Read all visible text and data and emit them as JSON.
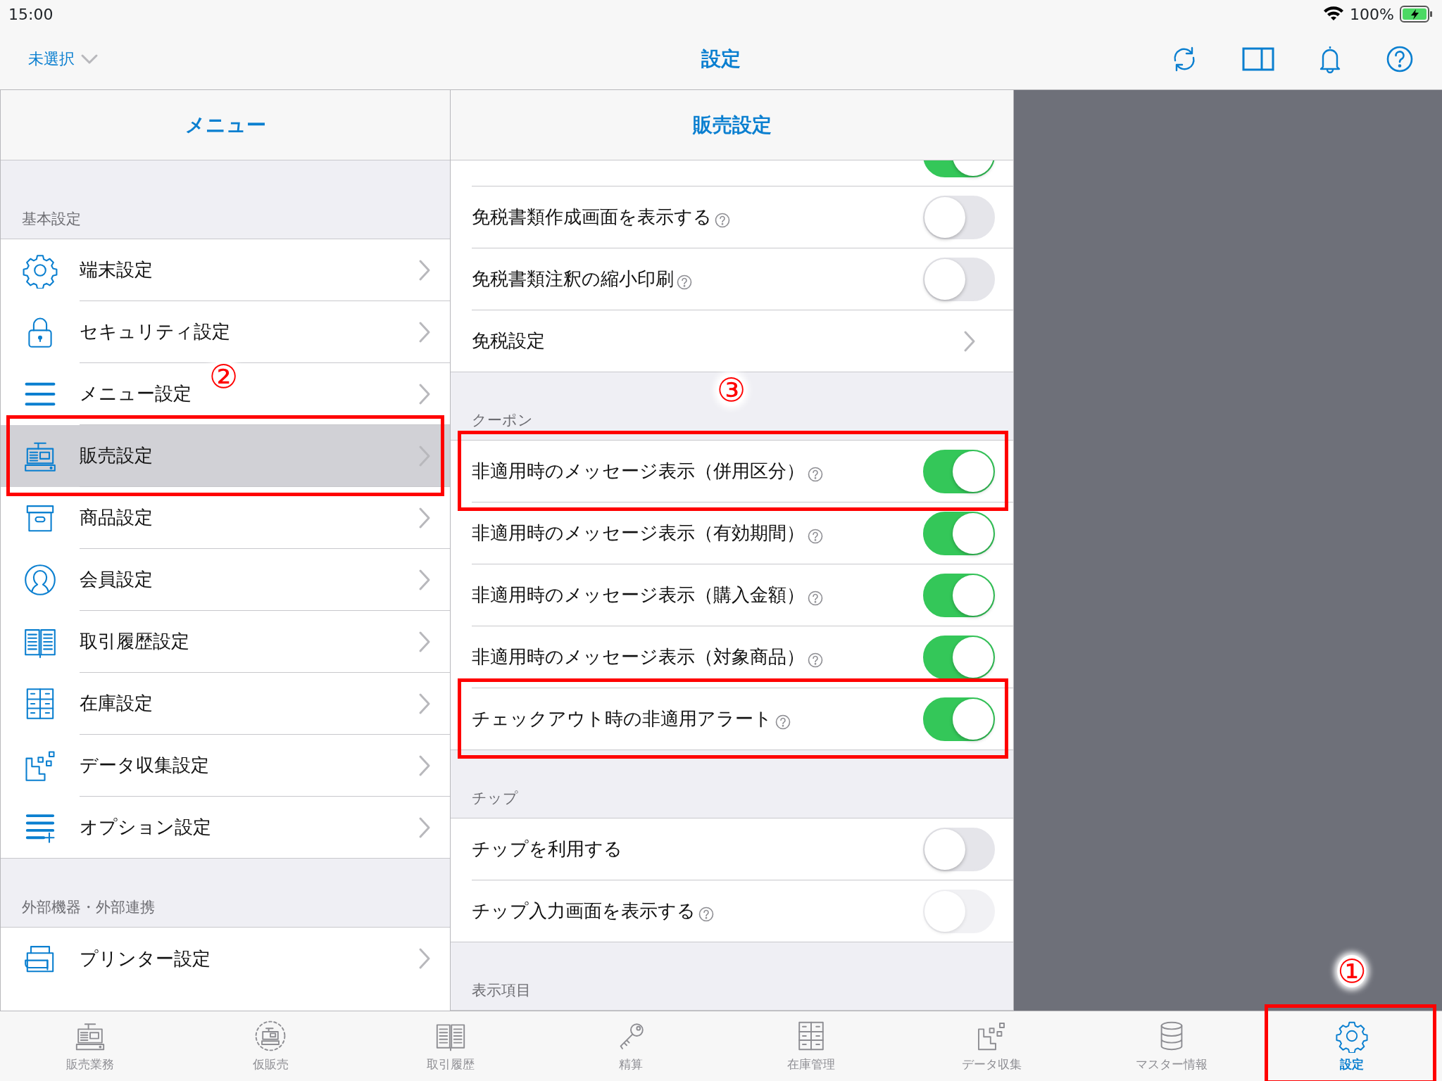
{
  "status_bar": {
    "time": "15:00",
    "battery": "100%"
  },
  "nav_bar": {
    "scope": "未選択",
    "title": "設定"
  },
  "menu": {
    "title": "メニュー",
    "sections": [
      {
        "header": "基本設定",
        "items": [
          {
            "label": "端末設定",
            "selected": false,
            "highlighted": false
          },
          {
            "label": "セキュリティ設定",
            "selected": false,
            "highlighted": false
          },
          {
            "label": "メニュー設定",
            "selected": false,
            "highlighted": false,
            "marker": "②"
          },
          {
            "label": "販売設定",
            "selected": true,
            "highlighted": true
          },
          {
            "label": "商品設定",
            "selected": false,
            "highlighted": false
          },
          {
            "label": "会員設定",
            "selected": false,
            "highlighted": false
          },
          {
            "label": "取引履歴設定",
            "selected": false,
            "highlighted": false
          },
          {
            "label": "在庫設定",
            "selected": false,
            "highlighted": false
          },
          {
            "label": "データ収集設定",
            "selected": false,
            "highlighted": false
          },
          {
            "label": "オプション設定",
            "selected": false,
            "highlighted": false
          }
        ]
      },
      {
        "header": "外部機器・外部連携",
        "items": [
          {
            "label": "プリンター設定",
            "selected": false,
            "highlighted": false
          }
        ]
      }
    ]
  },
  "detail": {
    "title": "販売設定",
    "sections": [
      {
        "rows": [
          {
            "kind": "toggle",
            "on": true,
            "disabled": false,
            "highlighted": false
          },
          {
            "kind": "toggle",
            "label": "免税書類作成画面を表示する",
            "help": true,
            "on": false,
            "disabled": false,
            "highlighted": false
          },
          {
            "kind": "toggle",
            "label": "免税書類注釈の縮小印刷",
            "help": true,
            "on": false,
            "disabled": false,
            "highlighted": false
          },
          {
            "kind": "link",
            "label": "免税設定",
            "highlighted": false
          }
        ]
      },
      {
        "header": "クーポン",
        "marker": "③",
        "rows": [
          {
            "kind": "toggle",
            "label": "非適用時のメッセージ表示（併用区分）",
            "help": true,
            "on": true,
            "disabled": false,
            "highlighted": true
          },
          {
            "kind": "toggle",
            "label": "非適用時のメッセージ表示（有効期間）",
            "help": true,
            "on": true,
            "disabled": false,
            "highlighted": false
          },
          {
            "kind": "toggle",
            "label": "非適用時のメッセージ表示（購入金額）",
            "help": true,
            "on": true,
            "disabled": false,
            "highlighted": false
          },
          {
            "kind": "toggle",
            "label": "非適用時のメッセージ表示（対象商品）",
            "help": true,
            "on": true,
            "disabled": false,
            "highlighted": false
          },
          {
            "kind": "toggle",
            "label": "チェックアウト時の非適用アラート",
            "help": true,
            "on": true,
            "disabled": false,
            "highlighted": true
          }
        ]
      },
      {
        "header": "チップ",
        "rows": [
          {
            "kind": "toggle",
            "label": "チップを利用する",
            "help": false,
            "on": false,
            "disabled": false,
            "highlighted": false
          },
          {
            "kind": "toggle",
            "label": "チップ入力画面を表示する",
            "help": true,
            "on": false,
            "disabled": true,
            "highlighted": false
          }
        ]
      },
      {
        "header": "表示項目"
      }
    ]
  },
  "tab_bar": [
    {
      "label": "販売業務",
      "selected": false,
      "highlighted": false
    },
    {
      "label": "仮販売",
      "selected": false,
      "highlighted": false
    },
    {
      "label": "取引履歴",
      "selected": false,
      "highlighted": false
    },
    {
      "label": "精算",
      "selected": false,
      "highlighted": false
    },
    {
      "label": "在庫管理",
      "selected": false,
      "highlighted": false
    },
    {
      "label": "データ収集",
      "selected": false,
      "highlighted": false
    },
    {
      "label": "マスター情報",
      "selected": false,
      "highlighted": false
    },
    {
      "label": "設定",
      "selected": true,
      "highlighted": true,
      "marker": "①"
    }
  ]
}
